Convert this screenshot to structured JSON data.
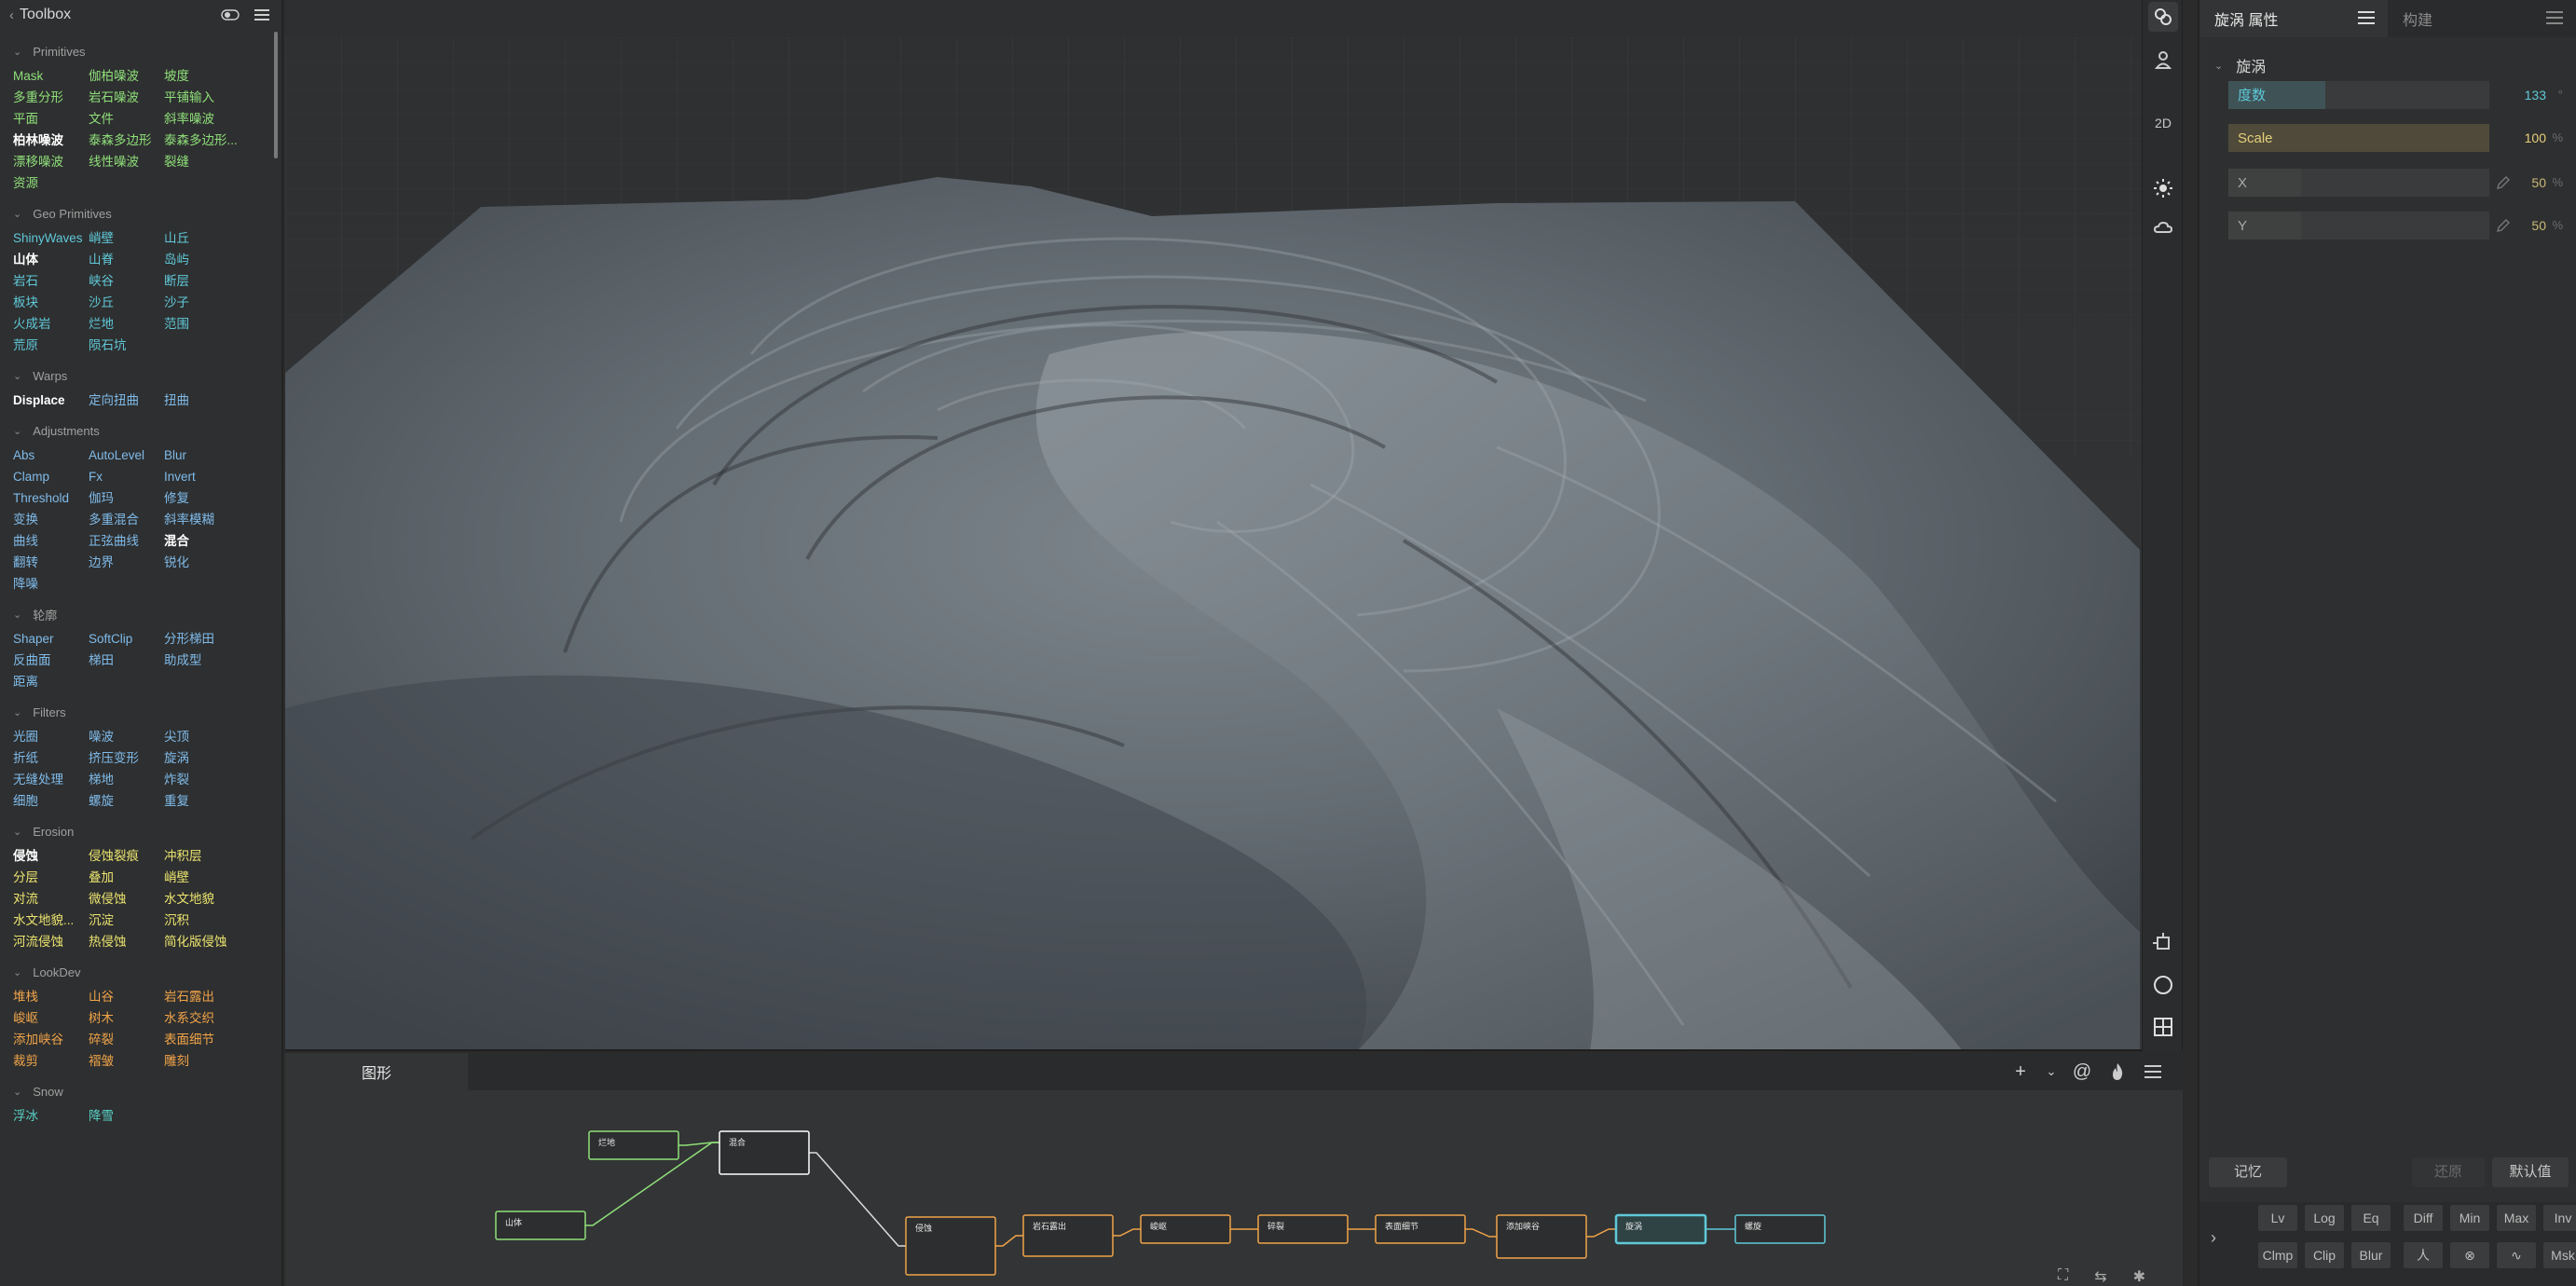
{
  "toolbox": {
    "title": "Toolbox",
    "categories": [
      {
        "name": "Primitives",
        "items": [
          {
            "label": "Mask",
            "color": "green",
            "bold": false
          },
          {
            "label": "伽柏噪波",
            "color": "green"
          },
          {
            "label": "坡度",
            "color": "green"
          },
          {
            "label": "多重分形",
            "color": "green"
          },
          {
            "label": "岩石噪波",
            "color": "green"
          },
          {
            "label": "平铺输入",
            "color": "green"
          },
          {
            "label": "平面",
            "color": "green"
          },
          {
            "label": "文件",
            "color": "green"
          },
          {
            "label": "斜率噪波",
            "color": "green"
          },
          {
            "label": "柏林噪波",
            "color": "green",
            "bold": true
          },
          {
            "label": "泰森多边形",
            "color": "green"
          },
          {
            "label": "泰森多边形...",
            "color": "green"
          },
          {
            "label": "漂移噪波",
            "color": "green"
          },
          {
            "label": "线性噪波",
            "color": "green"
          },
          {
            "label": "裂缝",
            "color": "green"
          },
          {
            "label": "资源",
            "color": "green"
          }
        ]
      },
      {
        "name": "Geo Primitives",
        "items": [
          {
            "label": "ShinyWaves",
            "color": "teal"
          },
          {
            "label": "峭壁",
            "color": "teal"
          },
          {
            "label": "山丘",
            "color": "teal"
          },
          {
            "label": "山体",
            "color": "teal",
            "bold": true
          },
          {
            "label": "山脊",
            "color": "teal"
          },
          {
            "label": "岛屿",
            "color": "teal"
          },
          {
            "label": "岩石",
            "color": "teal"
          },
          {
            "label": "峡谷",
            "color": "teal"
          },
          {
            "label": "断层",
            "color": "teal"
          },
          {
            "label": "板块",
            "color": "teal"
          },
          {
            "label": "沙丘",
            "color": "teal"
          },
          {
            "label": "沙子",
            "color": "teal"
          },
          {
            "label": "火成岩",
            "color": "teal"
          },
          {
            "label": "烂地",
            "color": "teal"
          },
          {
            "label": "范围",
            "color": "teal"
          },
          {
            "label": "荒原",
            "color": "teal"
          },
          {
            "label": "陨石坑",
            "color": "teal"
          }
        ]
      },
      {
        "name": "Warps",
        "items": [
          {
            "label": "Displace",
            "color": "blue",
            "bold": true
          },
          {
            "label": "定向扭曲",
            "color": "blue"
          },
          {
            "label": "扭曲",
            "color": "blue"
          }
        ]
      },
      {
        "name": "Adjustments",
        "items": [
          {
            "label": "Abs",
            "color": "blue"
          },
          {
            "label": "AutoLevel",
            "color": "blue"
          },
          {
            "label": "Blur",
            "color": "blue"
          },
          {
            "label": "Clamp",
            "color": "blue"
          },
          {
            "label": "Fx",
            "color": "blue"
          },
          {
            "label": "Invert",
            "color": "blue"
          },
          {
            "label": "Threshold",
            "color": "blue"
          },
          {
            "label": "伽玛",
            "color": "blue"
          },
          {
            "label": "修复",
            "color": "blue"
          },
          {
            "label": "变换",
            "color": "blue"
          },
          {
            "label": "多重混合",
            "color": "blue"
          },
          {
            "label": "斜率模糊",
            "color": "blue"
          },
          {
            "label": "曲线",
            "color": "blue"
          },
          {
            "label": "正弦曲线",
            "color": "blue"
          },
          {
            "label": "混合",
            "color": "blue",
            "bold": true
          },
          {
            "label": "翻转",
            "color": "blue"
          },
          {
            "label": "边界",
            "color": "blue"
          },
          {
            "label": "锐化",
            "color": "blue"
          },
          {
            "label": "降噪",
            "color": "blue"
          }
        ]
      },
      {
        "name": "轮廓",
        "items": [
          {
            "label": "Shaper",
            "color": "blue"
          },
          {
            "label": "SoftClip",
            "color": "blue"
          },
          {
            "label": "分形梯田",
            "color": "blue"
          },
          {
            "label": "反曲面",
            "color": "blue"
          },
          {
            "label": "梯田",
            "color": "blue"
          },
          {
            "label": "助成型",
            "color": "blue"
          },
          {
            "label": "距离",
            "color": "blue"
          }
        ]
      },
      {
        "name": "Filters",
        "items": [
          {
            "label": "光圈",
            "color": "blue"
          },
          {
            "label": "噪波",
            "color": "blue"
          },
          {
            "label": "尖顶",
            "color": "blue"
          },
          {
            "label": "折纸",
            "color": "blue"
          },
          {
            "label": "挤压变形",
            "color": "blue"
          },
          {
            "label": "旋涡",
            "color": "blue"
          },
          {
            "label": "无缝处理",
            "color": "blue"
          },
          {
            "label": "梯地",
            "color": "blue"
          },
          {
            "label": "炸裂",
            "color": "blue"
          },
          {
            "label": "细胞",
            "color": "blue"
          },
          {
            "label": "螺旋",
            "color": "blue"
          },
          {
            "label": "重复",
            "color": "blue"
          }
        ]
      },
      {
        "name": "Erosion",
        "items": [
          {
            "label": "侵蚀",
            "color": "yellow",
            "bold": true
          },
          {
            "label": "侵蚀裂痕",
            "color": "yellow"
          },
          {
            "label": "冲积层",
            "color": "yellow"
          },
          {
            "label": "分层",
            "color": "yellow"
          },
          {
            "label": "叠加",
            "color": "yellow"
          },
          {
            "label": "峭壁",
            "color": "yellow"
          },
          {
            "label": "对流",
            "color": "yellow"
          },
          {
            "label": "微侵蚀",
            "color": "yellow"
          },
          {
            "label": "水文地貌",
            "color": "yellow"
          },
          {
            "label": "水文地貌...",
            "color": "yellow"
          },
          {
            "label": "沉淀",
            "color": "yellow"
          },
          {
            "label": "沉积",
            "color": "yellow"
          },
          {
            "label": "河流侵蚀",
            "color": "yellow"
          },
          {
            "label": "热侵蚀",
            "color": "yellow"
          },
          {
            "label": "简化版侵蚀",
            "color": "yellow"
          }
        ]
      },
      {
        "name": "LookDev",
        "items": [
          {
            "label": "堆栈",
            "color": "orange"
          },
          {
            "label": "山谷",
            "color": "orange"
          },
          {
            "label": "岩石露出",
            "color": "orange"
          },
          {
            "label": "峻岖",
            "color": "orange"
          },
          {
            "label": "树木",
            "color": "orange"
          },
          {
            "label": "水系交织",
            "color": "orange"
          },
          {
            "label": "添加峡谷",
            "color": "orange"
          },
          {
            "label": "碎裂",
            "color": "orange"
          },
          {
            "label": "表面细节",
            "color": "orange"
          },
          {
            "label": "裁剪",
            "color": "orange"
          },
          {
            "label": "褶皱",
            "color": "orange"
          },
          {
            "label": "雕刻",
            "color": "orange"
          }
        ]
      },
      {
        "name": "Snow",
        "items": [
          {
            "label": "浮冰",
            "color": "teal2"
          },
          {
            "label": "降雪",
            "color": "teal2"
          }
        ]
      }
    ]
  },
  "viewport": {
    "tools": [
      "link-icon",
      "person-icon",
      "2D",
      "sun-icon",
      "cloud-icon",
      "frame-icon",
      "compass-icon",
      "grid-icon"
    ],
    "mode_label": "2D"
  },
  "graph": {
    "tab_label": "图形",
    "tool_icons": [
      "plus-icon",
      "chevron-down-icon",
      "at-icon",
      "flame-icon",
      "menu-icon"
    ],
    "nodes": [
      {
        "id": "n1",
        "label": "烂地",
        "color": "#8fe07a"
      },
      {
        "id": "n2",
        "label": "混合",
        "color": "#ffffff"
      },
      {
        "id": "n3",
        "label": "山体",
        "color": "#8fe07a"
      },
      {
        "id": "n4",
        "label": "侵蚀",
        "color": "#f0a449"
      },
      {
        "id": "n5",
        "label": "岩石露出",
        "color": "#f0a449"
      },
      {
        "id": "n6",
        "label": "峻岖",
        "color": "#f0a449"
      },
      {
        "id": "n7",
        "label": "碎裂",
        "color": "#f0a449"
      },
      {
        "id": "n8",
        "label": "表面细节",
        "color": "#f0a449"
      },
      {
        "id": "n9",
        "label": "添加峡谷",
        "color": "#f0a449"
      },
      {
        "id": "n10",
        "label": "旋涡",
        "color": "#5fc9d9"
      },
      {
        "id": "n11",
        "label": "螺旋",
        "color": "#5fc9d9"
      }
    ]
  },
  "props": {
    "tab_active": "旋涡 属性",
    "tab_other": "构建",
    "section": "旋涡",
    "fields": [
      {
        "label": "度数",
        "value": "133",
        "unit": "°",
        "fill": 0.37,
        "label_color": "#5fc9d9",
        "fill_color": "#3f5356"
      },
      {
        "label": "Scale",
        "value": "100",
        "unit": "%",
        "fill": 1.0,
        "label_color": "#e5cf7a",
        "fill_color": "#4f4a3a"
      },
      {
        "label": "X",
        "value": "50",
        "unit": "%",
        "fill": 0.28,
        "label_color": "#a8a8a8",
        "fill_color": "#3f4140"
      },
      {
        "label": "Y",
        "value": "50",
        "unit": "%",
        "fill": 0.28,
        "label_color": "#a8a8a8",
        "fill_color": "#3f4140"
      }
    ],
    "btn_memory": "记忆",
    "btn_restore": "还原",
    "btn_default": "默认值",
    "ops_row1": [
      "Lv",
      "Log",
      "Eq",
      "Diff",
      "Min",
      "Max",
      "Inv"
    ],
    "ops_row2": [
      "Clmp",
      "Clip",
      "Blur",
      "人",
      "⊗",
      "∿",
      "Msk"
    ]
  },
  "colors": {
    "green": "#8fe07a",
    "teal": "#5fc9d9",
    "blue": "#7fbbea",
    "yellow": "#ece56f",
    "orange": "#f0a449",
    "teal2": "#58d1c7"
  }
}
